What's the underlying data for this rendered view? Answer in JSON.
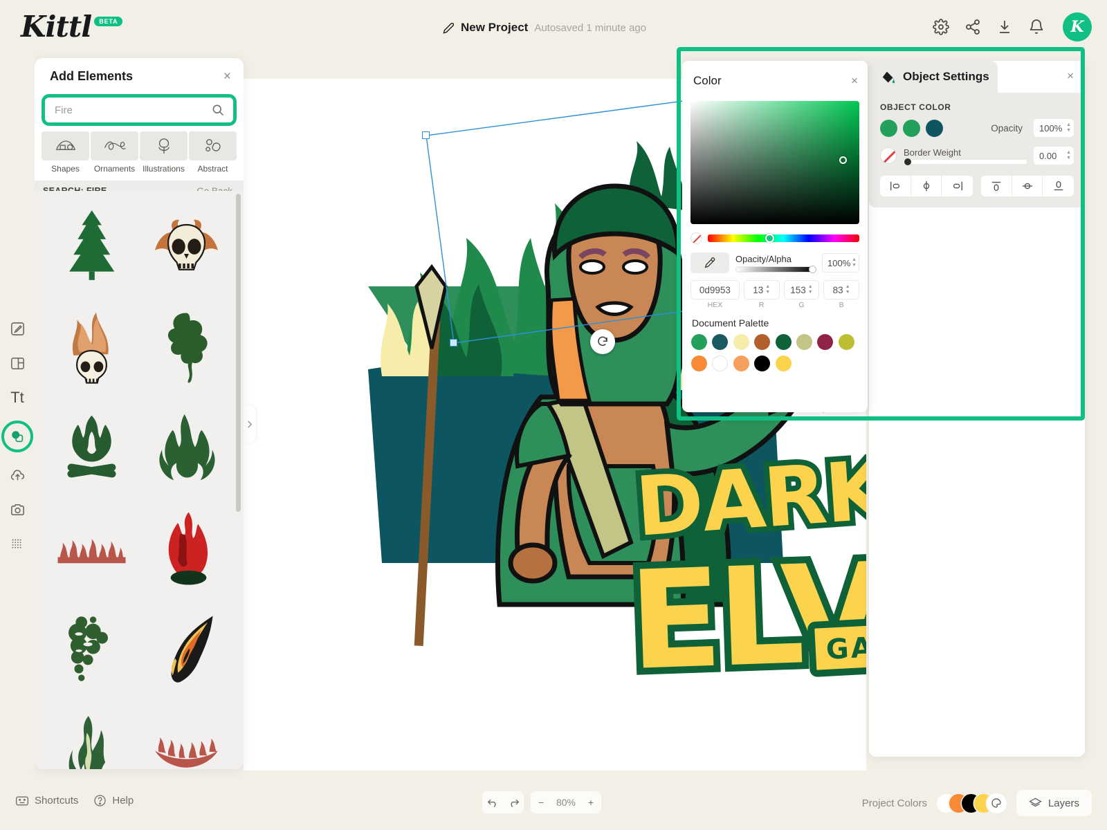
{
  "app": {
    "brand": "Kittl",
    "brand_badge": "BETA"
  },
  "header": {
    "project_title": "New Project",
    "autosave_text": "Autosaved 1 minute ago",
    "pencil_icon": "pencil-icon",
    "actions": [
      {
        "name": "settings-icon",
        "label": "Settings"
      },
      {
        "name": "share-icon",
        "label": "Share"
      },
      {
        "name": "download-icon",
        "label": "Download"
      },
      {
        "name": "notifications-icon",
        "label": "Notifications"
      }
    ],
    "avatar_letter": "K"
  },
  "tool_rail": {
    "items": [
      {
        "name": "design-icon",
        "label": "Design",
        "active": false
      },
      {
        "name": "templates-icon",
        "label": "Templates",
        "active": false
      },
      {
        "name": "text-icon",
        "label": "Tt",
        "active": false
      },
      {
        "name": "elements-icon",
        "label": "Elements",
        "active": true
      },
      {
        "name": "uploads-icon",
        "label": "Uploads",
        "active": false
      },
      {
        "name": "photos-icon",
        "label": "Photos",
        "active": false
      },
      {
        "name": "textures-icon",
        "label": "Textures",
        "active": false
      }
    ]
  },
  "elements_panel": {
    "title": "Add Elements",
    "close_label": "×",
    "search": {
      "value": "",
      "placeholder": "Fire",
      "icon": "search-icon"
    },
    "categories": [
      {
        "label": "Shapes",
        "icon": "shapes-icon"
      },
      {
        "label": "Ornaments",
        "icon": "ornaments-icon"
      },
      {
        "label": "Illustrations",
        "icon": "illustrations-icon"
      },
      {
        "label": "Abstract",
        "icon": "abstract-icon"
      }
    ],
    "results_header": "SEARCH: FIRE",
    "go_back": "Go Back",
    "results": [
      {
        "name": "pine-tree-element",
        "kind": "tree",
        "color": "#1f6b35"
      },
      {
        "name": "flaming-skull-element",
        "kind": "flame-skull",
        "color": "#c4743a"
      },
      {
        "name": "burning-skull-element",
        "kind": "fire-skull",
        "color": "#c07a44"
      },
      {
        "name": "green-smoke-element",
        "kind": "smoke",
        "color": "#2b5c2b"
      },
      {
        "name": "campfire-element",
        "kind": "campfire",
        "color": "#265c30"
      },
      {
        "name": "flame-element",
        "kind": "flame",
        "color": "#2b6033"
      },
      {
        "name": "fire-line-element",
        "kind": "fire-row",
        "color": "#b8564b"
      },
      {
        "name": "red-fire-element",
        "kind": "red-fire",
        "color": "#cc2222"
      },
      {
        "name": "smoke-cloud-element",
        "kind": "smoke-cloud",
        "color": "#2f5f2f"
      },
      {
        "name": "tribal-flame-element",
        "kind": "tribal-flame",
        "color": "#f0c255"
      },
      {
        "name": "wavy-flame-element",
        "kind": "wavy-flame",
        "color": "#2e6135"
      },
      {
        "name": "fire-arc-element",
        "kind": "fire-arc",
        "color": "#b8564b"
      }
    ],
    "collapse_icon": "chevron-right-icon"
  },
  "color_popover": {
    "title": "Color",
    "close_label": "×",
    "eyedropper_icon": "eyedropper-icon",
    "alpha_label": "Opacity/Alpha",
    "alpha_value": "100%",
    "hex_value": "0d9953",
    "hex_label": "HEX",
    "r_value": "13",
    "r_label": "R",
    "g_value": "153",
    "g_label": "G",
    "b_value": "83",
    "b_label": "B",
    "palette_label": "Document Palette",
    "palette": [
      "#23a05c",
      "#1a5a60",
      "#f6edaa",
      "#b35f2c",
      "#0f6137",
      "#c2c585",
      "#91234a",
      "#bdbf33",
      "#f98a35",
      "#ffffff",
      "#f79f5c",
      "#000000",
      "#fbd34c"
    ],
    "selected_color": "#0d9953"
  },
  "object_settings": {
    "title": "Object Settings",
    "icon": "paint-bucket-icon",
    "close_label": "×",
    "section_label": "OBJECT COLOR",
    "swatches": [
      "#23a05c",
      "#23a05c",
      "#0d5560"
    ],
    "opacity_label": "Opacity",
    "opacity_value": "100%",
    "border_label": "Border Weight",
    "border_value": "0.00",
    "align_buttons": [
      {
        "name": "align-left-icon",
        "label": "Align left"
      },
      {
        "name": "align-center-horizontal-icon",
        "label": "Align center"
      },
      {
        "name": "align-right-icon",
        "label": "Align right"
      },
      {
        "name": "align-top-icon",
        "label": "Align top"
      },
      {
        "name": "align-middle-vertical-icon",
        "label": "Align middle"
      },
      {
        "name": "align-bottom-icon",
        "label": "Align bottom"
      }
    ]
  },
  "canvas": {
    "artwork_title": "DARK",
    "artwork_title2": "ELVEN",
    "artwork_subtitle": "GAMING",
    "rotate_icon": "rotate-icon"
  },
  "bottom_bar": {
    "shortcuts_label": "Shortcuts",
    "shortcuts_icon": "keyboard-icon",
    "help_label": "Help",
    "help_icon": "question-icon",
    "undo_icon": "undo-icon",
    "redo_icon": "redo-icon",
    "zoom_minus": "−",
    "zoom_value": "80%",
    "zoom_plus": "+",
    "project_colors_label": "Project Colors",
    "project_colors": [
      "#ffffff",
      "#f98a35",
      "#000000",
      "#fbd34c"
    ],
    "project_colors_icon": "palette-icon",
    "layers_label": "Layers",
    "layers_icon": "layers-icon"
  }
}
